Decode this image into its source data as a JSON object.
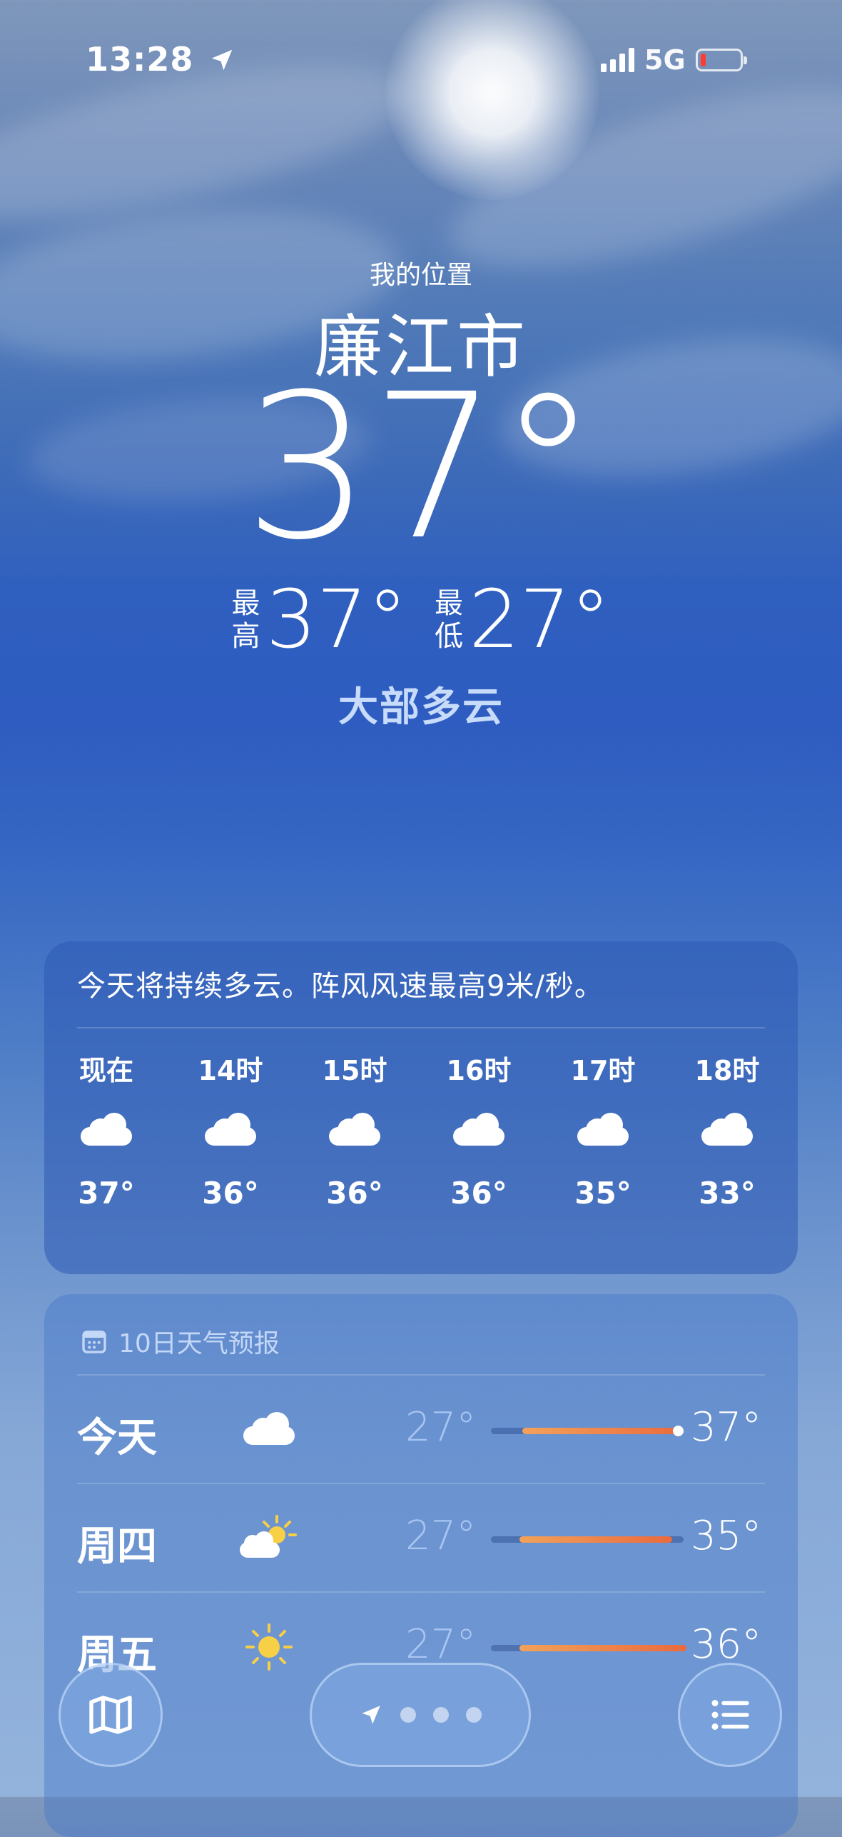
{
  "status_bar": {
    "time": "13:28",
    "network": "5G"
  },
  "header": {
    "location_label": "我的位置",
    "city": "廉江市",
    "current_temp": "37°",
    "high_label_1": "最",
    "high_label_2": "高",
    "high": "37°",
    "low_label_1": "最",
    "low_label_2": "低",
    "low": "27°",
    "condition": "大部多云"
  },
  "hourly": {
    "summary": "今天将持续多云。阵风风速最高9米/秒。",
    "items": [
      {
        "time": "现在",
        "icon": "cloud-icon",
        "temp": "37°"
      },
      {
        "time": "14时",
        "icon": "cloud-icon",
        "temp": "36°"
      },
      {
        "time": "15时",
        "icon": "cloud-icon",
        "temp": "36°"
      },
      {
        "time": "16时",
        "icon": "cloud-icon",
        "temp": "36°"
      },
      {
        "time": "17时",
        "icon": "cloud-icon",
        "temp": "35°"
      },
      {
        "time": "18时",
        "icon": "cloud-icon",
        "temp": "33°"
      }
    ]
  },
  "daily": {
    "title": "10日天气预报",
    "items": [
      {
        "day": "今天",
        "icon": "cloud-icon",
        "low": "27°",
        "high": "37°"
      },
      {
        "day": "周四",
        "icon": "partly-sunny-icon",
        "low": "27°",
        "high": "35°"
      },
      {
        "day": "周五",
        "icon": "sun-icon",
        "low": "27°",
        "high": "36°"
      }
    ]
  },
  "colors": {
    "range_start": "#f2a25a",
    "range_end": "#ea6a3e",
    "low_temp": "#a9c6f2",
    "condition": "#c7dcfa"
  }
}
